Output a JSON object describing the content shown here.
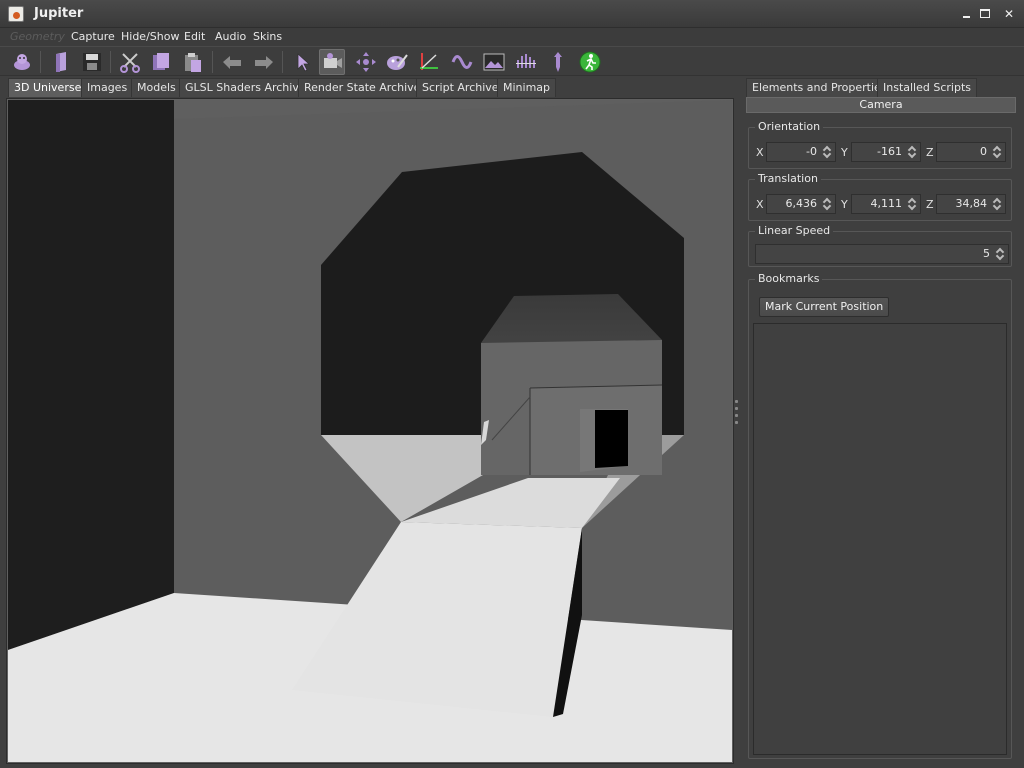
{
  "window": {
    "title": "Jupiter"
  },
  "menu": {
    "items": [
      {
        "label": "Geometry",
        "enabled": false
      },
      {
        "label": "Capture",
        "enabled": true
      },
      {
        "label": "Hide/Show",
        "enabled": true
      },
      {
        "label": "Edit",
        "enabled": true
      },
      {
        "label": "Audio",
        "enabled": true
      },
      {
        "label": "Skins",
        "enabled": true
      }
    ]
  },
  "toolbar": {
    "buttons": [
      "character-icon",
      "open-icon",
      "save-icon",
      "cut-icon",
      "copy-icon",
      "paste-icon",
      "undo-icon",
      "redo-icon",
      "select-icon",
      "camera-icon",
      "move-icon",
      "paint-icon",
      "axes-icon",
      "wave-icon",
      "image-icon",
      "equalizer-icon",
      "pin-icon",
      "run-icon"
    ],
    "active": "camera-icon"
  },
  "tabs_left": {
    "items": [
      "3D Universe",
      "Images",
      "Models",
      "GLSL Shaders Archive",
      "Render State Archive",
      "Script Archive",
      "Minimap"
    ],
    "selected": "3D Universe"
  },
  "tabs_right": {
    "items": [
      "Elements and Properties",
      "Installed Scripts"
    ]
  },
  "camera": {
    "header": "Camera",
    "orientation": {
      "title": "Orientation",
      "x_label": "X",
      "y_label": "Y",
      "z_label": "Z",
      "x": "-0",
      "y": "-161",
      "z": "0"
    },
    "translation": {
      "title": "Translation",
      "x_label": "X",
      "y_label": "Y",
      "z_label": "Z",
      "x": "6,436",
      "y": "4,111",
      "z": "34,84"
    },
    "linear_speed": {
      "title": "Linear Speed",
      "value": "5"
    },
    "bookmarks": {
      "title": "Bookmarks",
      "mark_button": "Mark Current Position"
    }
  },
  "colors": {
    "panel_bg": "#3f3f3f",
    "tab_selected": "#5e5e5e",
    "accent_purple": "#a98ad0",
    "run_green": "#3ab53a"
  }
}
